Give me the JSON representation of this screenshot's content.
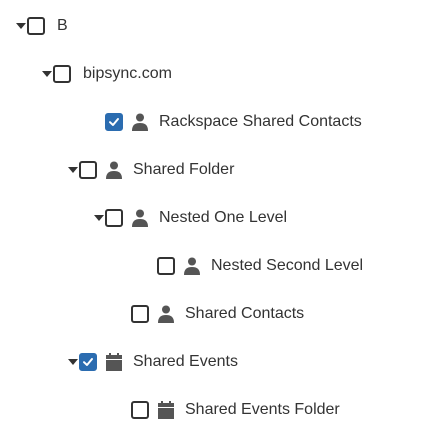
{
  "tree": {
    "nodes": [
      {
        "id": "b",
        "label": "B",
        "checked": false,
        "expanded": true,
        "icon": "none"
      },
      {
        "id": "bipsync",
        "label": "bipsync.com",
        "checked": false,
        "expanded": true,
        "icon": "none"
      },
      {
        "id": "rackspace-shared-contacts",
        "label": "Rackspace Shared Contacts",
        "checked": true,
        "icon": "person-icon"
      },
      {
        "id": "shared-folder",
        "label": "Shared Folder",
        "checked": false,
        "expanded": true,
        "icon": "person-icon"
      },
      {
        "id": "nested-one-level",
        "label": "Nested One Level",
        "checked": false,
        "expanded": true,
        "icon": "person-icon"
      },
      {
        "id": "nested-second-level",
        "label": "Nested Second Level",
        "checked": false,
        "icon": "person-icon"
      },
      {
        "id": "shared-contacts",
        "label": "Shared Contacts",
        "checked": false,
        "icon": "person-icon"
      },
      {
        "id": "shared-events",
        "label": "Shared Events",
        "checked": true,
        "expanded": true,
        "icon": "calendar-icon"
      },
      {
        "id": "shared-events-folder",
        "label": "Shared Events Folder",
        "checked": false,
        "icon": "calendar-icon"
      }
    ]
  },
  "colors": {
    "text": "#333333",
    "icon": "#555555",
    "checkbox_checked": "#2b6cb0"
  }
}
